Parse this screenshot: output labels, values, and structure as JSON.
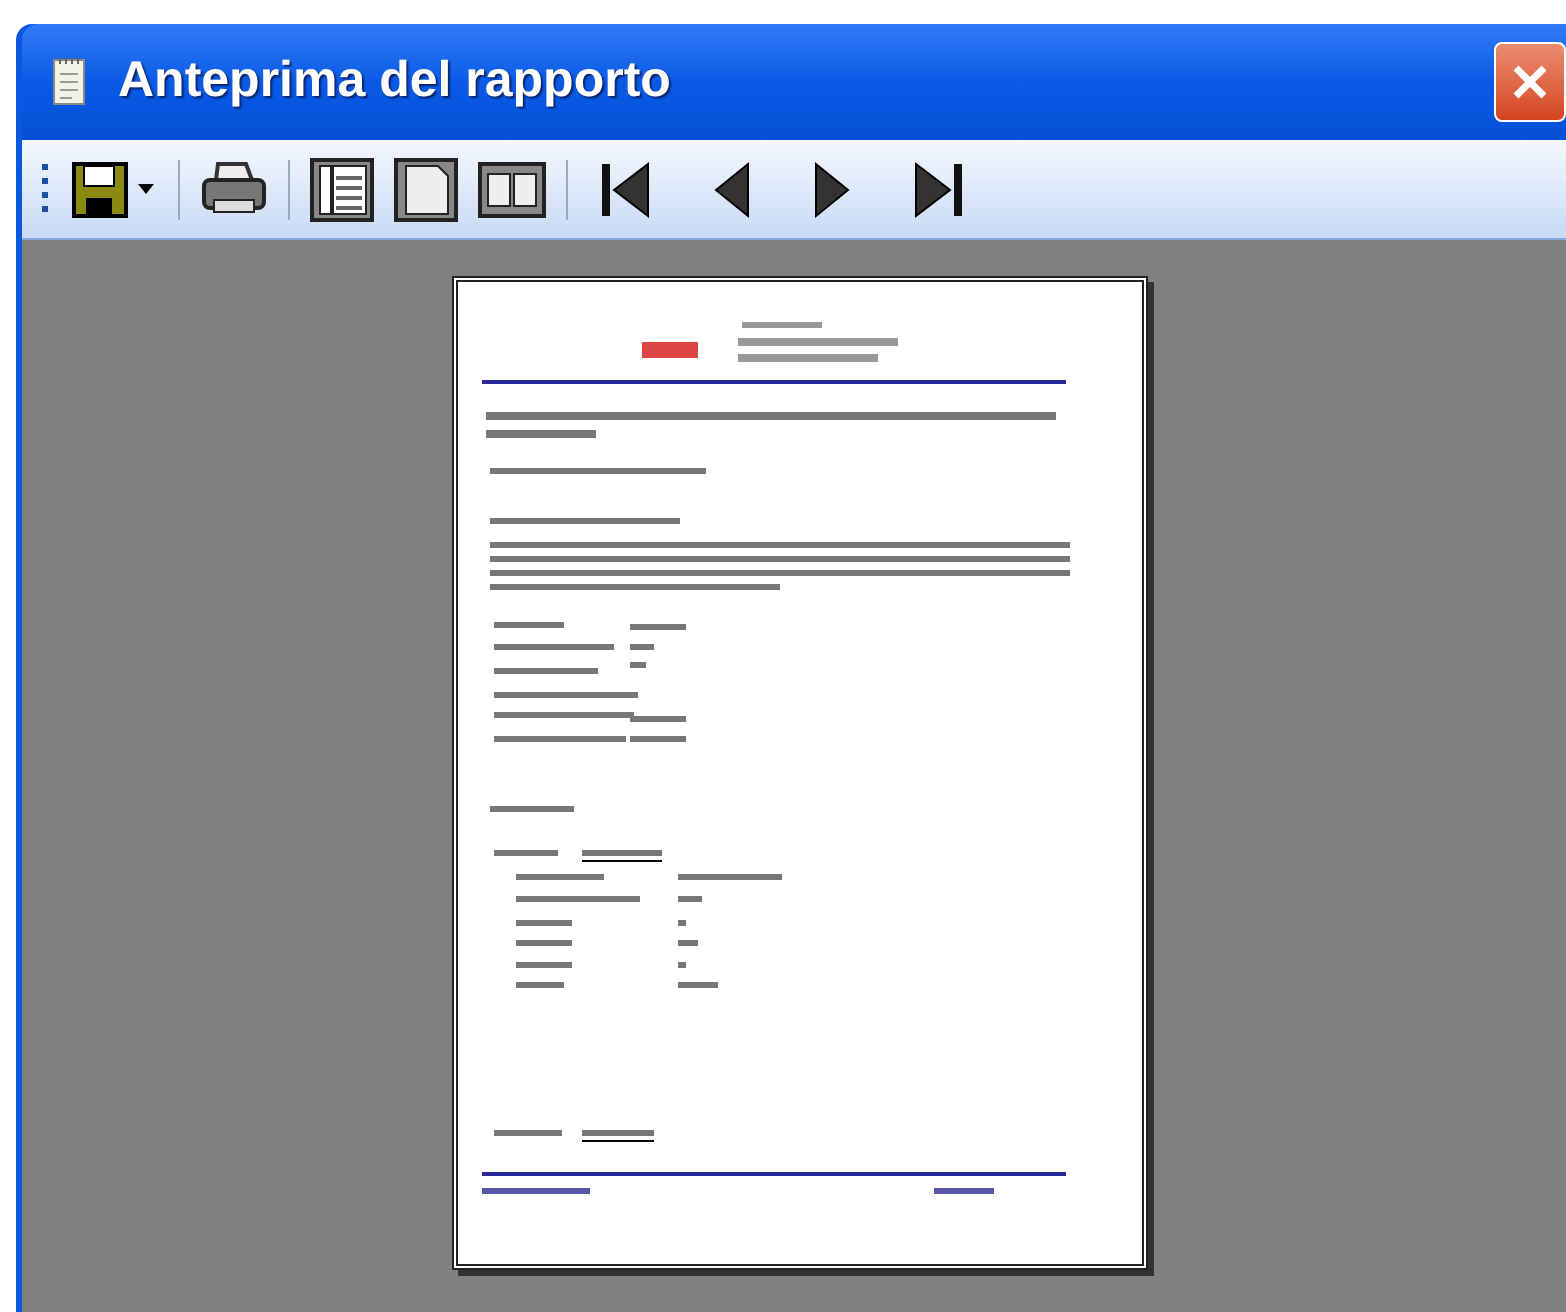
{
  "window": {
    "title": "Anteprima del rapporto"
  }
}
